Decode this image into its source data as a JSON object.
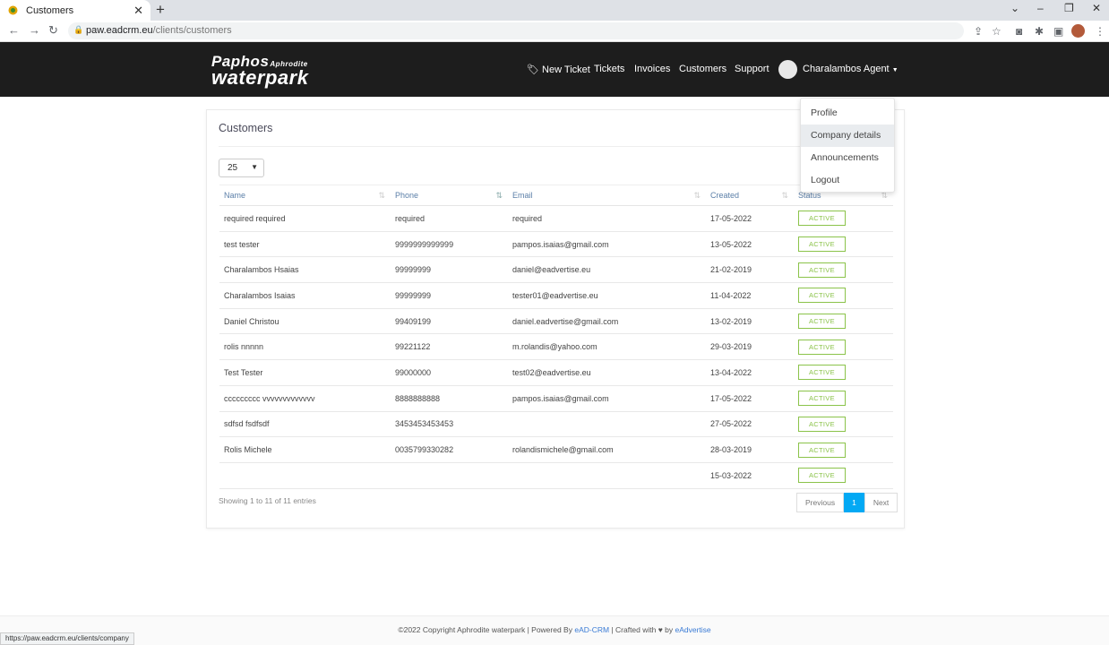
{
  "browser": {
    "tab_title": "Customers",
    "new_tab": "+",
    "url_host": "paw.eadcrm.eu",
    "url_path": "/clients/customers",
    "status_url": "https://paw.eadcrm.eu/clients/company"
  },
  "header": {
    "logo_line1": "Paphos",
    "logo_line1_small": "Aphrodite",
    "logo_line2": "waterpark",
    "nav": {
      "new_ticket": "New Ticket",
      "tickets": "Tickets",
      "invoices": "Invoices",
      "customers": "Customers",
      "support": "Support",
      "user": "Charalambos Agent"
    }
  },
  "dropdown": [
    "Profile",
    "Company details",
    "Announcements",
    "Logout"
  ],
  "card": {
    "title": "Customers",
    "page_size": "25",
    "columns": [
      "Name",
      "Phone",
      "Email",
      "Created",
      "Status"
    ],
    "rows": [
      [
        "required required",
        "required",
        "required",
        "17-05-2022",
        "ACTIVE"
      ],
      [
        "test tester",
        "9999999999999",
        "pampos.isaias@gmail.com",
        "13-05-2022",
        "ACTIVE"
      ],
      [
        "Charalambos Hsaias",
        "99999999",
        "daniel@eadvertise.eu",
        "21-02-2019",
        "ACTIVE"
      ],
      [
        "Charalambos Isaias",
        "99999999",
        "tester01@eadvertise.eu",
        "11-04-2022",
        "ACTIVE"
      ],
      [
        "Daniel Christou",
        "99409199",
        "daniel.eadvertise@gmail.com",
        "13-02-2019",
        "ACTIVE"
      ],
      [
        "rolis nnnnn",
        "99221122",
        "m.rolandis@yahoo.com",
        "29-03-2019",
        "ACTIVE"
      ],
      [
        "Test Tester",
        "99000000",
        "test02@eadvertise.eu",
        "13-04-2022",
        "ACTIVE"
      ],
      [
        "ccccccccc vvvvvvvvvvvvv",
        "8888888888",
        "pampos.isaias@gmail.com",
        "17-05-2022",
        "ACTIVE"
      ],
      [
        "sdfsd fsdfsdf",
        "3453453453453",
        "",
        "27-05-2022",
        "ACTIVE"
      ],
      [
        "Rolis Michele",
        "0035799330282",
        "rolandismichele@gmail.com",
        "28-03-2019",
        "ACTIVE"
      ],
      [
        "",
        "",
        "",
        "15-03-2022",
        "ACTIVE"
      ]
    ],
    "showing": "Showing 1 to 11 of 11 entries",
    "pager": {
      "previous": "Previous",
      "current": "1",
      "next": "Next"
    }
  },
  "footer": {
    "text1": "©2022 Copyright Aphrodite waterpark | Powered By ",
    "link1": "eAD-CRM",
    "text2": " | Crafted with ",
    "text3": " by ",
    "link2": "eAdvertise"
  },
  "colors": {
    "header_bg": "#1d1d1d",
    "accent": "#03a9f4",
    "active_badge": "#8bc34a"
  }
}
